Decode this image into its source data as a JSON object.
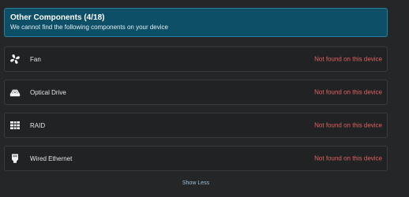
{
  "header": {
    "title": "Other Components (4/18)",
    "subtitle": "We cannot find the following components on your device"
  },
  "components": [
    {
      "icon": "fan-icon",
      "label": "Fan",
      "status": "Not found on this device"
    },
    {
      "icon": "optical-drive-icon",
      "label": "Optical Drive",
      "status": "Not found on this device"
    },
    {
      "icon": "raid-icon",
      "label": "RAID",
      "status": "Not found on this device"
    },
    {
      "icon": "ethernet-icon",
      "label": "Wired Ethernet",
      "status": "Not found on this device"
    }
  ],
  "footer": {
    "show_less_label": "Show Less"
  },
  "colors": {
    "header_bg": "#0d4f67",
    "status_error": "#e0615f",
    "link": "#9fc0d8"
  }
}
